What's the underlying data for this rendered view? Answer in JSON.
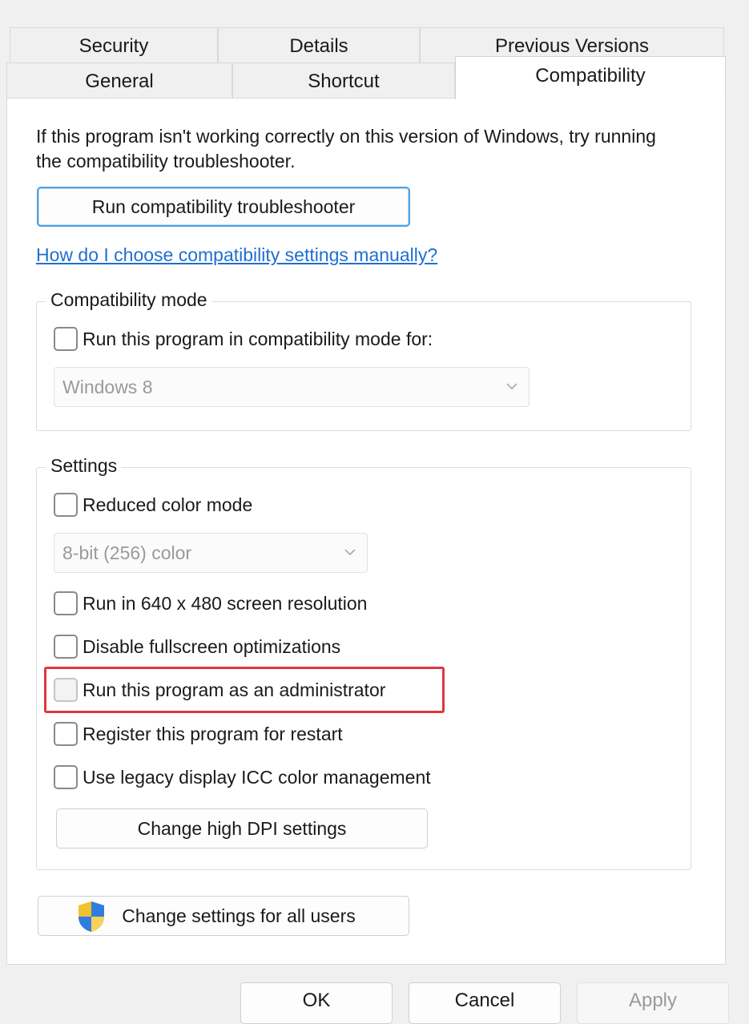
{
  "tabs": {
    "row_back": [
      "Security",
      "Details",
      "Previous Versions"
    ],
    "row_front": [
      "General",
      "Shortcut",
      "Compatibility"
    ],
    "active": "Compatibility"
  },
  "intro_text": "If this program isn't working correctly on this version of Windows, try running the compatibility troubleshooter.",
  "troubleshooter_button": "Run compatibility troubleshooter",
  "help_link": "How do I choose compatibility settings manually?",
  "compat_mode": {
    "legend": "Compatibility mode",
    "checkbox_label": "Run this program in compatibility mode for:",
    "os_value": "Windows 8"
  },
  "settings": {
    "legend": "Settings",
    "reduced_color": "Reduced color mode",
    "color_value": "8-bit (256) color",
    "res_640": "Run in 640 x 480 screen resolution",
    "disable_fullscreen": "Disable fullscreen optimizations",
    "run_as_admin": "Run this program as an administrator",
    "register_restart": "Register this program for restart",
    "legacy_icc": "Use legacy display ICC color management",
    "high_dpi_button": "Change high DPI settings"
  },
  "all_users_button": "Change settings for all users",
  "footer": {
    "ok": "OK",
    "cancel": "Cancel",
    "apply": "Apply"
  },
  "colors": {
    "highlight": "#e0373c",
    "link": "#1f6fd0",
    "focus": "#4e9fe0"
  },
  "icons": {
    "uac_shield": "uac-shield-icon",
    "combo_chevron": "chevron-down-icon"
  }
}
